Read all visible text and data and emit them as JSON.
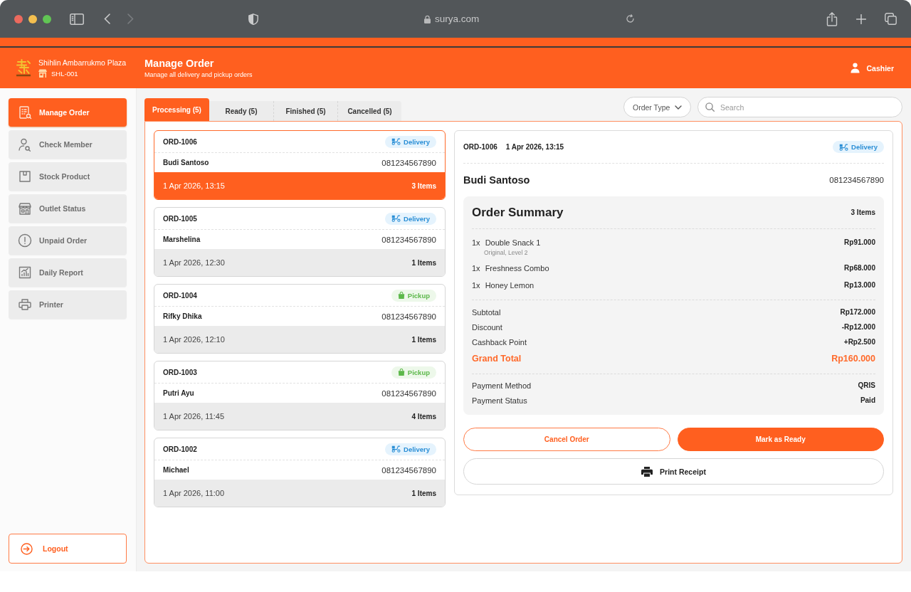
{
  "browser": {
    "url": "surya.com",
    "forward_disabled": true
  },
  "header": {
    "store_name": "Shihlin Ambarrukmo Plaza",
    "store_code": "SHL-001",
    "title": "Manage Order",
    "subtitle": "Manage all delivery and pickup orders",
    "user": "Cashier"
  },
  "sidebar": {
    "items": [
      {
        "label": "Manage Order",
        "selected": true
      },
      {
        "label": "Check Member",
        "selected": false
      },
      {
        "label": "Stock Product",
        "selected": false
      },
      {
        "label": "Outlet Status",
        "selected": false
      },
      {
        "label": "Unpaid Order",
        "selected": false
      },
      {
        "label": "Daily Report",
        "selected": false
      },
      {
        "label": "Printer",
        "selected": false
      }
    ],
    "logout": "Logout"
  },
  "tabs": [
    {
      "label": "Processing (5)",
      "selected": true
    },
    {
      "label": "Ready (5)",
      "selected": false
    },
    {
      "label": "Finished (5)",
      "selected": false
    },
    {
      "label": "Cancelled (5)",
      "selected": false
    }
  ],
  "filters": {
    "order_type": "Order Type",
    "search": {
      "placeholder": "Search"
    }
  },
  "orders": [
    {
      "id": "ORD-1006",
      "type": {
        "kind": "delivery",
        "label": "Delivery"
      },
      "customer": "Budi Santoso",
      "phone": "081234567890",
      "time": "1 Apr 2026, 13:15",
      "items": "3 Items",
      "selected": true
    },
    {
      "id": "ORD-1005",
      "type": {
        "kind": "delivery",
        "label": "Delivery"
      },
      "customer": "Marshelina",
      "phone": "081234567890",
      "time": "1 Apr 2026, 12:30",
      "items": "1 Items",
      "selected": false
    },
    {
      "id": "ORD-1004",
      "type": {
        "kind": "pickup",
        "label": "Pickup"
      },
      "customer": "Rifky Dhika",
      "phone": "081234567890",
      "time": "1 Apr 2026, 12:10",
      "items": "1 Items",
      "selected": false
    },
    {
      "id": "ORD-1003",
      "type": {
        "kind": "pickup",
        "label": "Pickup"
      },
      "customer": "Putri Ayu",
      "phone": "081234567890",
      "time": "1 Apr 2026, 11:45",
      "items": "4 Items",
      "selected": false
    },
    {
      "id": "ORD-1002",
      "type": {
        "kind": "delivery",
        "label": "Delivery"
      },
      "customer": "Michael",
      "phone": "081234567890",
      "time": "1 Apr 2026, 11:00",
      "items": "1 Items",
      "selected": false
    }
  ],
  "detail": {
    "order_id": "ORD-1006",
    "time": "1 Apr 2026, 13:15",
    "type": {
      "kind": "delivery",
      "label": "Delivery"
    },
    "customer": "Budi Santoso",
    "phone": "081234567890",
    "summary": {
      "title": "Order Summary",
      "count": "3 Items",
      "items": [
        {
          "qty": "1x",
          "name": "Double Snack 1",
          "note": "Original, Level 2",
          "price": "Rp91.000"
        },
        {
          "qty": "1x",
          "name": "Freshness Combo",
          "price": "Rp68.000"
        },
        {
          "qty": "1x",
          "name": "Honey Lemon",
          "price": "Rp13.000"
        }
      ],
      "totals": [
        {
          "label": "Subtotal",
          "value": "Rp172.000"
        },
        {
          "label": "Discount",
          "value": "-Rp12.000"
        },
        {
          "label": "Cashback Point",
          "value": "+Rp2.500"
        }
      ],
      "grand_total": {
        "label": "Grand Total",
        "value": "Rp160.000"
      },
      "payment": [
        {
          "label": "Payment Method",
          "value": "QRIS"
        },
        {
          "label": "Payment Status",
          "value": "Paid"
        }
      ]
    },
    "actions": {
      "cancel": "Cancel Order",
      "ready": "Mark as Ready",
      "print": "Print Receipt"
    }
  }
}
